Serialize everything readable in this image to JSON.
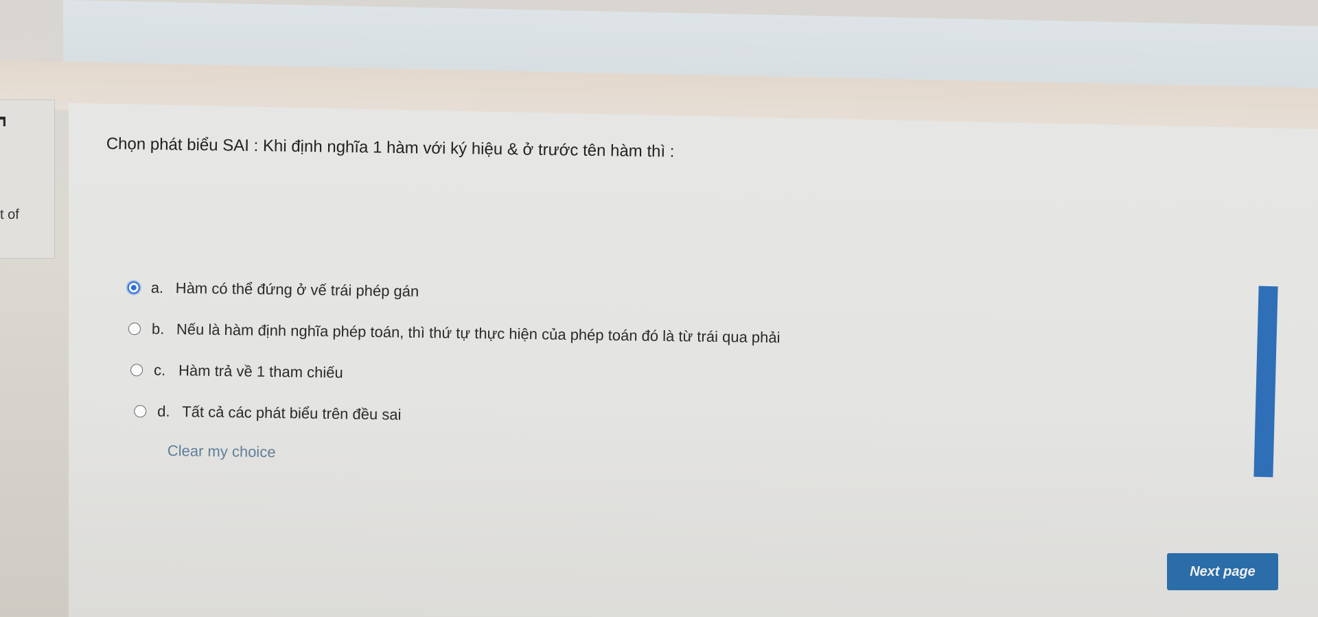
{
  "side_info": {
    "fragment_text": "t of"
  },
  "question": {
    "text": "Chọn phát biểu SAI : Khi  định nghĩa 1 hàm với ký hiệu & ở trước tên hàm  thì :"
  },
  "answers": [
    {
      "letter": "a.",
      "text": "Hàm có thể đứng ở vế trái phép gán",
      "selected": true
    },
    {
      "letter": "b.",
      "text": "Nếu là hàm định nghĩa phép toán, thì thứ tự thực hiện của phép toán đó là từ trái qua phải",
      "selected": false
    },
    {
      "letter": "c.",
      "text": "Hàm trả về 1 tham chiếu",
      "selected": false
    },
    {
      "letter": "d.",
      "text": "Tất cả các phát biểu trên đều sai",
      "selected": false
    }
  ],
  "actions": {
    "clear_choice_label": "Clear my choice",
    "next_page_label": "Next page"
  },
  "colors": {
    "accent": "#2f6fd8",
    "button": "#2a6da8",
    "link": "#5f7f9a"
  }
}
